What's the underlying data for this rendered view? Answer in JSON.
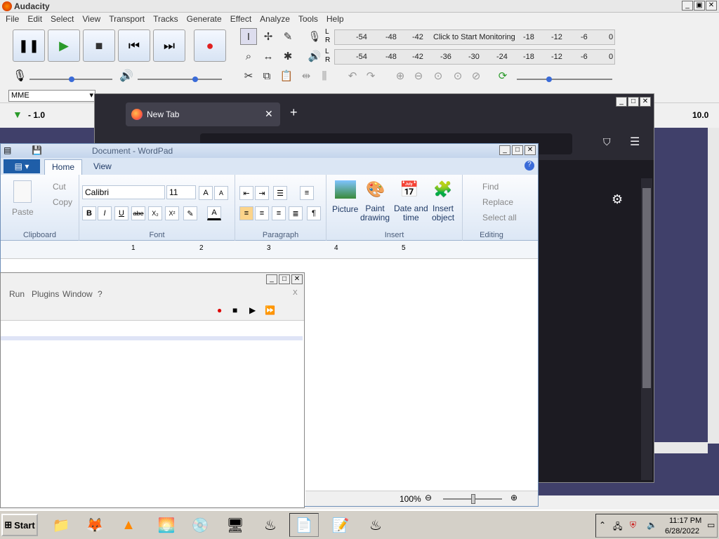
{
  "audacity": {
    "title": "Audacity",
    "menu": [
      "File",
      "Edit",
      "Select",
      "View",
      "Transport",
      "Tracks",
      "Generate",
      "Effect",
      "Analyze",
      "Tools",
      "Help"
    ],
    "record_meter": {
      "lr": [
        "L",
        "R"
      ],
      "ticks": [
        "-54",
        "-48",
        "-42"
      ],
      "prompt": "Click to Start Monitoring",
      "ticks2": [
        "-18",
        "-12",
        "-6",
        "0"
      ]
    },
    "play_meter": {
      "lr": [
        "L",
        "R"
      ],
      "ticks": [
        "-54",
        "-48",
        "-42",
        "-36",
        "-30",
        "-24",
        "-18",
        "-12",
        "-6",
        "0"
      ]
    },
    "host_select": "MME",
    "timeline": {
      "start": "- 1.0",
      "end": "10.0"
    }
  },
  "firefox": {
    "tab_title": "New Tab",
    "new_tab_symbol": "+"
  },
  "wordpad": {
    "title": "Document - WordPad",
    "tabs": [
      "Home",
      "View"
    ],
    "clipboard": {
      "paste": "Paste",
      "cut": "Cut",
      "copy": "Copy",
      "label": "Clipboard"
    },
    "font": {
      "name": "Calibri",
      "size": "11",
      "label": "Font",
      "grow": "A",
      "shrink": "A",
      "bold": "B",
      "italic": "I",
      "underline": "U",
      "strike": "abe",
      "sub": "X₂",
      "sup": "X²"
    },
    "paragraph": {
      "label": "Paragraph"
    },
    "insert": {
      "picture": "Picture",
      "paint": "Paint\ndrawing",
      "datetime": "Date and\ntime",
      "object": "Insert\nobject",
      "label": "Insert"
    },
    "editing": {
      "find": "Find",
      "replace": "Replace",
      "select_all": "Select all",
      "label": "Editing"
    },
    "ruler": [
      "1",
      "2",
      "3",
      "4",
      "5"
    ],
    "zoom": "100%"
  },
  "side_window": {
    "menu": [
      "Run",
      "Plugins",
      "Window",
      "?"
    ],
    "close_x": "X"
  },
  "taskbar": {
    "start": "Start",
    "time": "11:17 PM",
    "date": "6/28/2022"
  }
}
